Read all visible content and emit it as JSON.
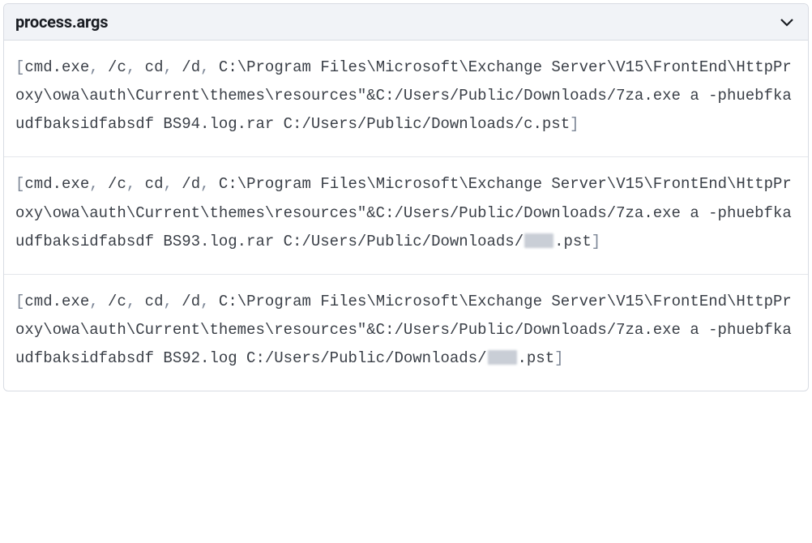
{
  "header": {
    "title": "process.args",
    "expanded": true
  },
  "rows": [
    {
      "args": [
        "cmd.exe",
        "/c",
        "cd",
        "/d",
        "C:\\Program Files\\Microsoft\\Exchange Server\\V15\\FrontEnd\\HttpProxy\\owa\\auth\\Current\\themes\\resources\"&C:/Users/Public/Downloads/7za.exe a -phuebfkaudfbaksidfabsdf BS94.log.rar C:/Users/Public/Downloads/c.pst"
      ],
      "redacted_segments": []
    },
    {
      "args": [
        "cmd.exe",
        "/c",
        "cd",
        "/d",
        "C:\\Program Files\\Microsoft\\Exchange Server\\V15\\FrontEnd\\HttpProxy\\owa\\auth\\Current\\themes\\resources\"&C:/Users/Public/Downloads/7za.exe a -phuebfkaudfbaksidfabsdf BS93.log.rar C:/Users/Public/Downloads/",
        ".pst"
      ],
      "redacted_segments": [
        5
      ]
    },
    {
      "args": [
        "cmd.exe",
        "/c",
        "cd",
        "/d",
        "C:\\Program Files\\Microsoft\\Exchange Server\\V15\\FrontEnd\\HttpProxy\\owa\\auth\\Current\\themes\\resources\"&C:/Users/Public/Downloads/7za.exe a -phuebfkaudfbaksidfabsdf BS92.log C:/Users/Public/Downloads/",
        ".pst"
      ],
      "redacted_segments": [
        5
      ]
    }
  ],
  "bracket_open": "[",
  "bracket_close": "]",
  "separator": ", "
}
